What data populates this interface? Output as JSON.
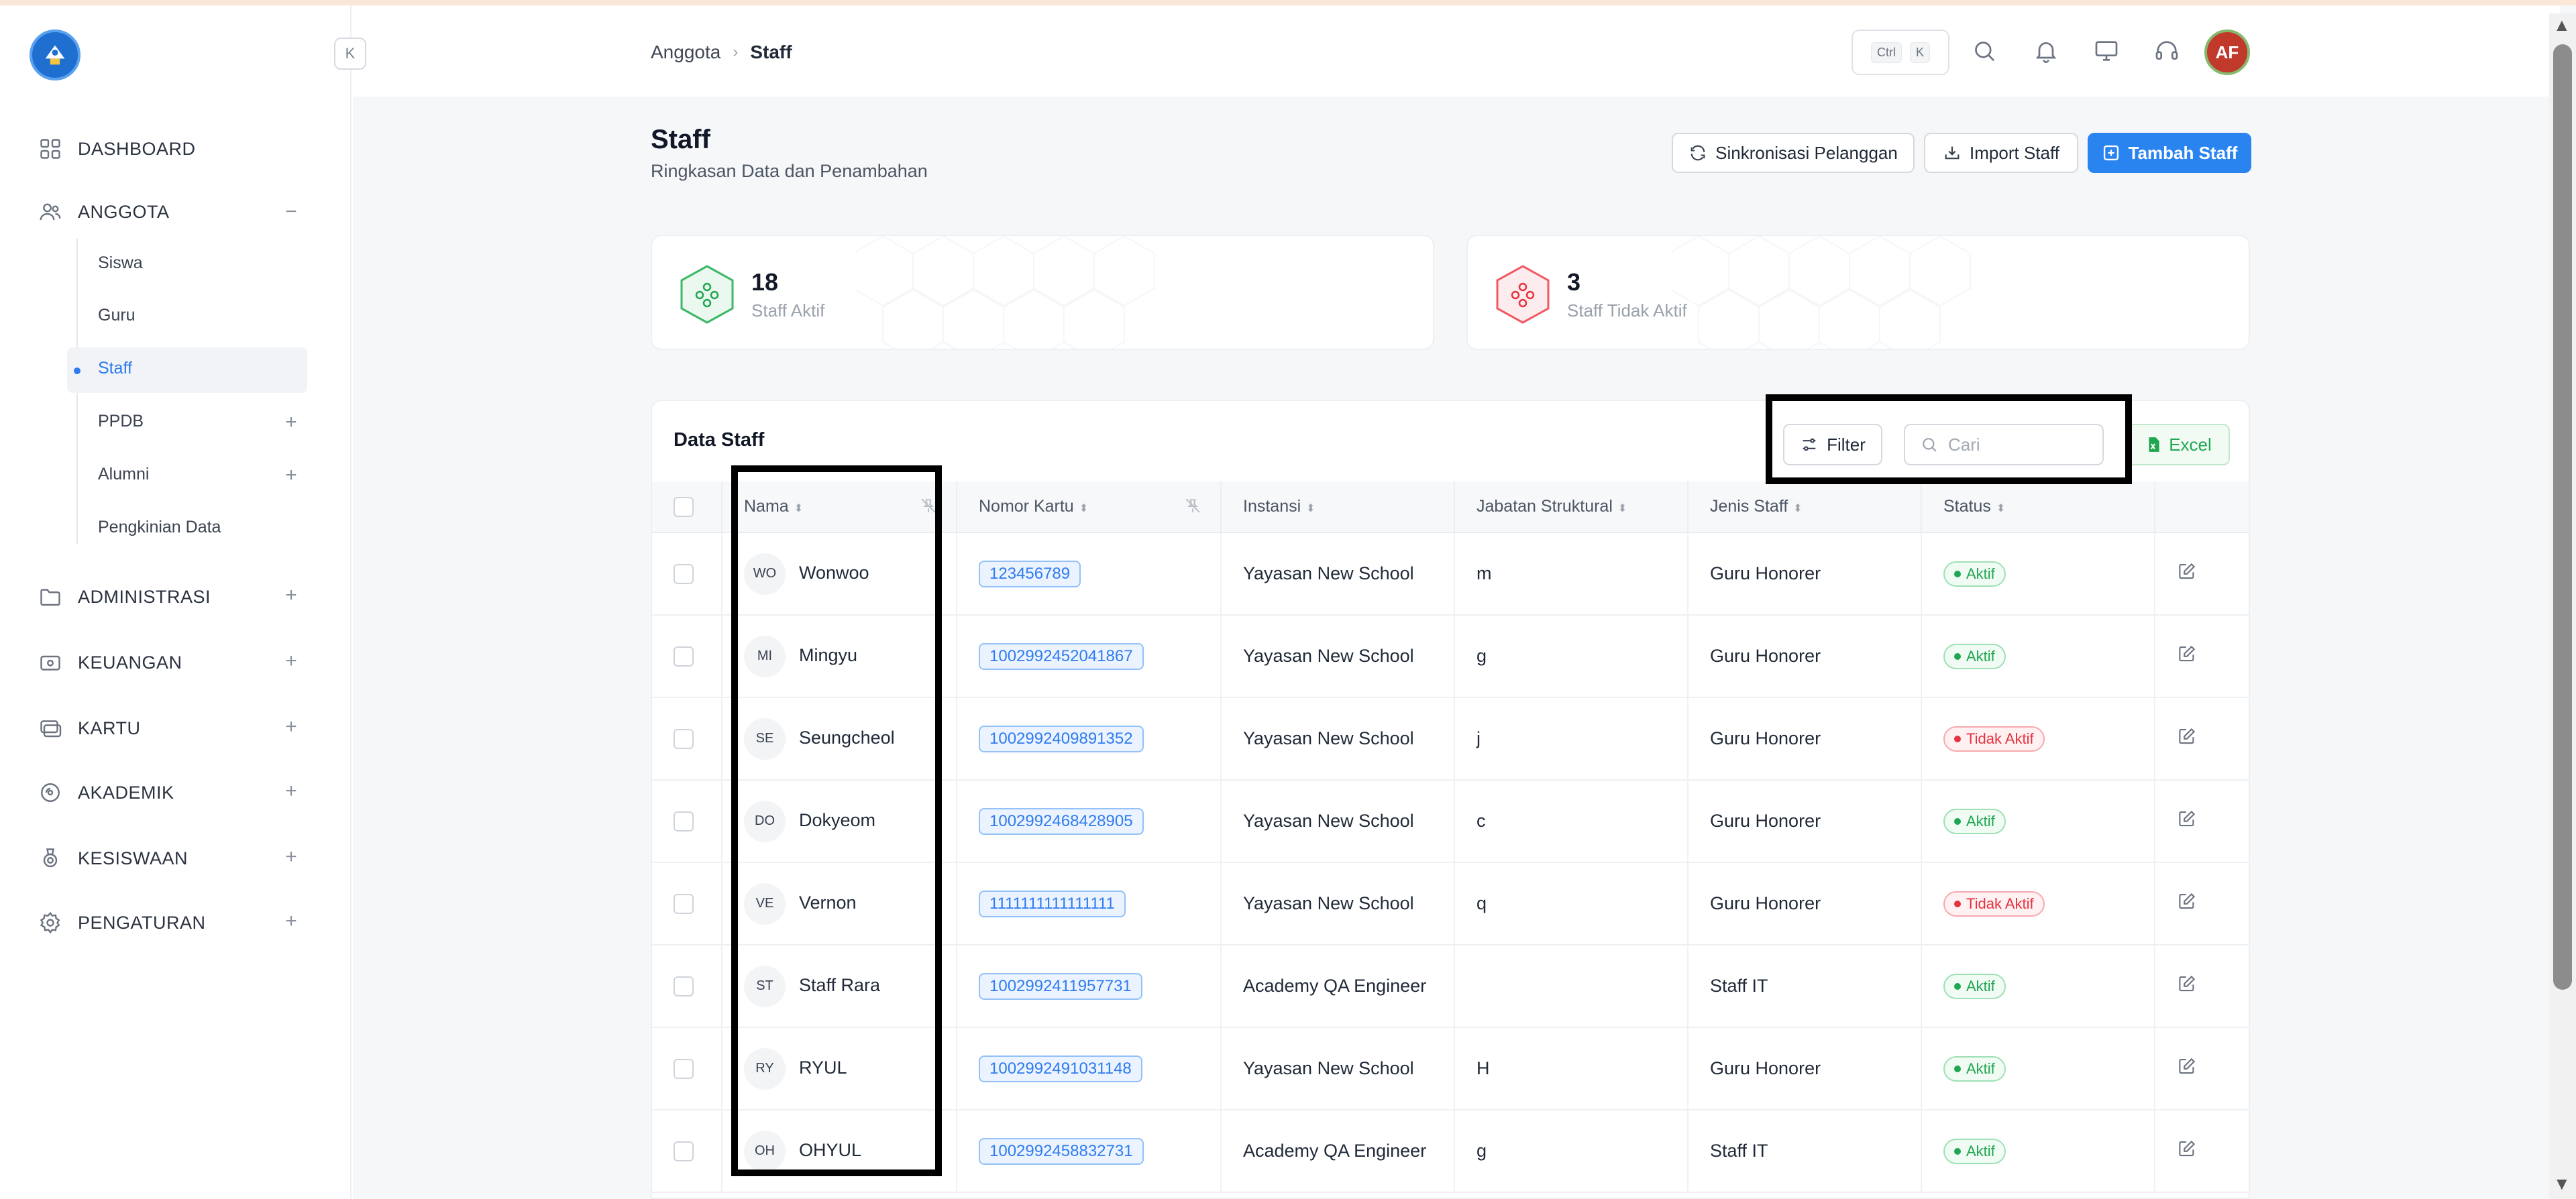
{
  "breadcrumb": {
    "parent": "Anggota",
    "separator": "›",
    "current": "Staff"
  },
  "header": {
    "kbd_ctrl": "Ctrl",
    "kbd_k": "K",
    "avatar_initials": "AF"
  },
  "page": {
    "title": "Staff",
    "subtitle": "Ringkasan Data dan Penambahan"
  },
  "actions": {
    "sync": "Sinkronisasi Pelanggan",
    "import": "Import Staff",
    "add": "Tambah Staff"
  },
  "stats": {
    "active": {
      "value": "18",
      "label": "Staff Aktif",
      "color": "#1fa650"
    },
    "inactive": {
      "value": "3",
      "label": "Staff Tidak Aktif",
      "color": "#e5323f"
    }
  },
  "sidebar": {
    "dashboard": "DASHBOARD",
    "anggota": "ANGGOTA",
    "anggota_collapse": "−",
    "sub": {
      "siswa": "Siswa",
      "guru": "Guru",
      "staff": "Staff",
      "ppdb": "PPDB",
      "alumni": "Alumni",
      "pengkinian": "Pengkinian Data"
    },
    "administrasi": "ADMINISTRASI",
    "keuangan": "KEUANGAN",
    "kartu": "KARTU",
    "akademik": "AKADEMIK",
    "kesiswaan": "KESISWAAN",
    "pengaturan": "PENGATURAN",
    "plus": "+",
    "collapse_btn": "K"
  },
  "table": {
    "title": "Data Staff",
    "filter": "Filter",
    "search_placeholder": "Cari",
    "excel": "Excel",
    "columns": {
      "nama": "Nama",
      "nomor_kartu": "Nomor Kartu",
      "instansi": "Instansi",
      "jabatan": "Jabatan Struktural",
      "jenis": "Jenis Staff",
      "status": "Status"
    },
    "sort_glyph": "⬍",
    "rows": [
      {
        "initials": "WO",
        "name": "Wonwoo",
        "card": "123456789",
        "instansi": "Yayasan New School",
        "jabatan": "m",
        "jenis": "Guru Honorer",
        "status": "Aktif",
        "active": true
      },
      {
        "initials": "MI",
        "name": "Mingyu",
        "card": "1002992452041867",
        "instansi": "Yayasan New School",
        "jabatan": "g",
        "jenis": "Guru Honorer",
        "status": "Aktif",
        "active": true
      },
      {
        "initials": "SE",
        "name": "Seungcheol",
        "card": "1002992409891352",
        "instansi": "Yayasan New School",
        "jabatan": "j",
        "jenis": "Guru Honorer",
        "status": "Tidak Aktif",
        "active": false
      },
      {
        "initials": "DO",
        "name": "Dokyeom",
        "card": "1002992468428905",
        "instansi": "Yayasan New School",
        "jabatan": "c",
        "jenis": "Guru Honorer",
        "status": "Aktif",
        "active": true
      },
      {
        "initials": "VE",
        "name": "Vernon",
        "card": "1111111111111111",
        "instansi": "Yayasan New School",
        "jabatan": "q",
        "jenis": "Guru Honorer",
        "status": "Tidak Aktif",
        "active": false
      },
      {
        "initials": "ST",
        "name": "Staff Rara",
        "card": "1002992411957731",
        "instansi": "Academy QA Engineer",
        "jabatan": "",
        "jenis": "Staff IT",
        "status": "Aktif",
        "active": true
      },
      {
        "initials": "RY",
        "name": "RYUL",
        "card": "1002992491031148",
        "instansi": "Yayasan New School",
        "jabatan": "H",
        "jenis": "Guru Honorer",
        "status": "Aktif",
        "active": true
      },
      {
        "initials": "OH",
        "name": "OHYUL",
        "card": "1002992458832731",
        "instansi": "Academy QA Engineer",
        "jabatan": "g",
        "jenis": "Staff IT",
        "status": "Aktif",
        "active": true
      }
    ]
  }
}
